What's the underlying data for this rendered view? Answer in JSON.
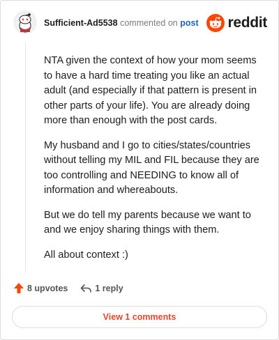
{
  "comment": {
    "author": "Sufficient-Ad5538",
    "action_text": "commented on",
    "post_link": "post",
    "paragraphs": [
      "NTA given the context of how your mom seems to have a hard time treating you like an actual adult (and especially if that pattern is present in other parts of your life). You are already doing more than enough with the post cards.",
      "My husband and I go to cities/states/countries without telling my MIL and FIL because they are too controlling and NEEDING to know all of information and whereabouts.",
      "But we do tell my parents because we want to and we enjoy sharing things with them.",
      "All about context :)"
    ],
    "upvotes": "8 upvotes",
    "replies": "1 reply"
  },
  "brand": {
    "name": "reddit",
    "color": "#ff4500"
  },
  "footer": {
    "view_comments": "View 1 comments"
  },
  "icons": {
    "avatar": "snoo-avatar-icon",
    "logo": "reddit-logo-icon",
    "upvote": "upvote-arrow-icon",
    "reply": "reply-arrow-icon"
  },
  "colors": {
    "link": "#1d64b8",
    "accent": "#e2452a",
    "upvote": "#ff4500"
  }
}
